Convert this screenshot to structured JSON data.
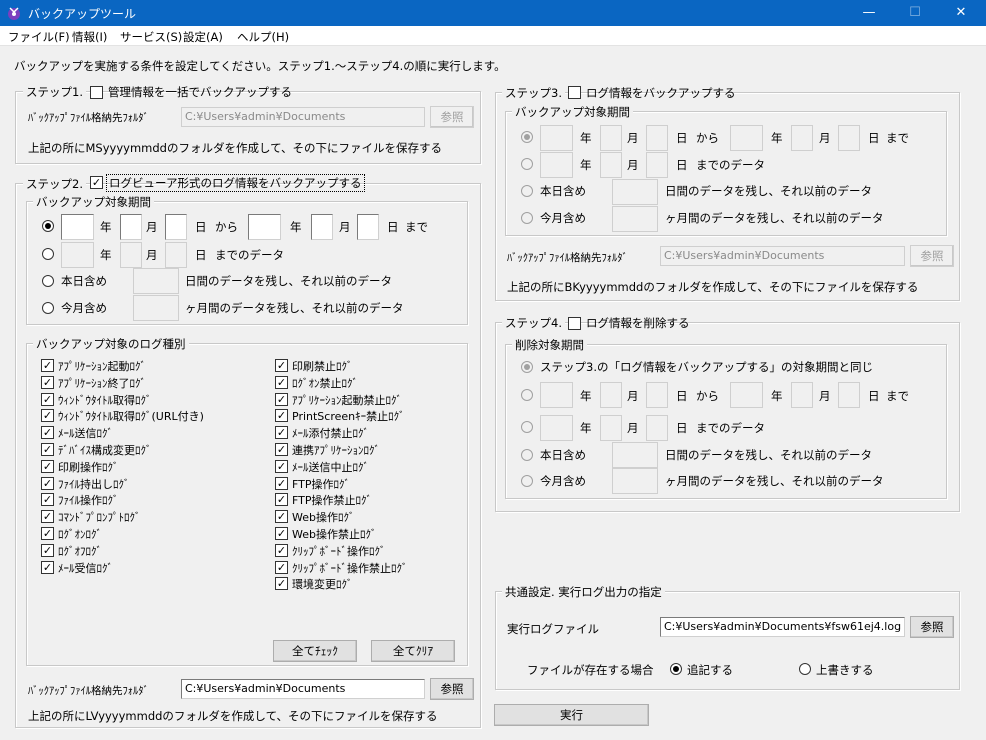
{
  "window": {
    "title": "バックアップツール",
    "min": "—",
    "max": "☐",
    "close": "✕"
  },
  "menu": [
    "ファイル(F)",
    "情報(I)",
    "サービス(S)",
    "設定(A)",
    "ヘルプ(H)"
  ],
  "intro": "バックアップを実施する条件を設定してください。ステップ1.〜ステップ4.の順に実行します。",
  "step1": {
    "title": "ステップ1.",
    "cb_label": "管理情報を一括でバックアップする",
    "path_label": "ﾊﾞｯｸｱｯﾌﾟﾌｧｲﾙ格納先ﾌｫﾙﾀﾞ",
    "path": "C:¥Users¥admin¥Documents",
    "browse": "参照",
    "note": "上記の所にMSyyyymmddのフォルダを作成して、その下にファイルを保存する"
  },
  "step2": {
    "title": "ステップ2.",
    "cb_label": "ログビューア形式のログ情報をバックアップする",
    "period_title": "バックアップ対象期間",
    "y": "年",
    "m": "月",
    "d": "日",
    "from": "から",
    "to": "まで",
    "until": "までのデータ",
    "today_label": "本日含め",
    "days_text": "日間のデータを残し、それ以前のデータ",
    "month_label": "今月含め",
    "months_text": "ヶ月間のデータを残し、それ以前のデータ",
    "logtypes_title": "バックアップ対象のログ種別",
    "left_logs": [
      "ｱﾌﾟﾘｹｰｼｮﾝ起動ﾛｸﾞ",
      "ｱﾌﾟﾘｹｰｼｮﾝ終了ﾛｸﾞ",
      "ｳｨﾝﾄﾞｳﾀｲﾄﾙ取得ﾛｸﾞ",
      "ｳｨﾝﾄﾞｳﾀｲﾄﾙ取得ﾛｸﾞ(URL付き)",
      "ﾒｰﾙ送信ﾛｸﾞ",
      "ﾃﾞﾊﾞｲｽ構成変更ﾛｸﾞ",
      "印刷操作ﾛｸﾞ",
      "ﾌｧｲﾙ持出しﾛｸﾞ",
      "ﾌｧｲﾙ操作ﾛｸﾞ",
      "ｺﾏﾝﾄﾞﾌﾟﾛﾝﾌﾟﾄﾛｸﾞ",
      "ﾛｸﾞｵﾝﾛｸﾞ",
      "ﾛｸﾞｵﾌﾛｸﾞ",
      "ﾒｰﾙ受信ﾛｸﾞ"
    ],
    "right_logs": [
      "印刷禁止ﾛｸﾞ",
      "ﾛｸﾞｵﾝ禁止ﾛｸﾞ",
      "ｱﾌﾟﾘｹｰｼｮﾝ起動禁止ﾛｸﾞ",
      "PrintScreenｷｰ禁止ﾛｸﾞ",
      "ﾒｰﾙ添付禁止ﾛｸﾞ",
      "連携ｱﾌﾟﾘｹｰｼｮﾝﾛｸﾞ",
      "ﾒｰﾙ送信中止ﾛｸﾞ",
      "FTP操作ﾛｸﾞ",
      "FTP操作禁止ﾛｸﾞ",
      "Web操作ﾛｸﾞ",
      "Web操作禁止ﾛｸﾞ",
      "ｸﾘｯﾌﾟﾎﾞｰﾄﾞ操作ﾛｸﾞ",
      "ｸﾘｯﾌﾟﾎﾞｰﾄﾞ操作禁止ﾛｸﾞ",
      "環境変更ﾛｸﾞ"
    ],
    "check_all": "全てﾁｪｯｸ",
    "clear_all": "全てｸﾘｱ",
    "path_label": "ﾊﾞｯｸｱｯﾌﾟﾌｧｲﾙ格納先ﾌｫﾙﾀﾞ",
    "path": "C:¥Users¥admin¥Documents",
    "browse": "参照",
    "note": "上記の所にLVyyyymmddのフォルダを作成して、その下にファイルを保存する"
  },
  "step3": {
    "title": "ステップ3.",
    "cb_label": "ログ情報をバックアップする",
    "period_title": "バックアップ対象期間",
    "path_label": "ﾊﾞｯｸｱｯﾌﾟﾌｧｲﾙ格納先ﾌｫﾙﾀﾞ",
    "path": "C:¥Users¥admin¥Documents",
    "browse": "参照",
    "note": "上記の所にBKyyyymmddのフォルダを作成して、その下にファイルを保存する"
  },
  "step4": {
    "title": "ステップ4.",
    "cb_label": "ログ情報を削除する",
    "period_title": "削除対象期間",
    "same_label": "ステップ3.の「ログ情報をバックアップする」の対象期間と同じ"
  },
  "common": {
    "title": "共通設定. 実行ログ出力の指定",
    "log_label": "実行ログファイル",
    "log_path": "C:¥Users¥admin¥Documents¥fsw61ej4.log",
    "browse": "参照",
    "exists_label": "ファイルが存在する場合",
    "append": "追記する",
    "overwrite": "上書きする"
  },
  "run": "実行"
}
